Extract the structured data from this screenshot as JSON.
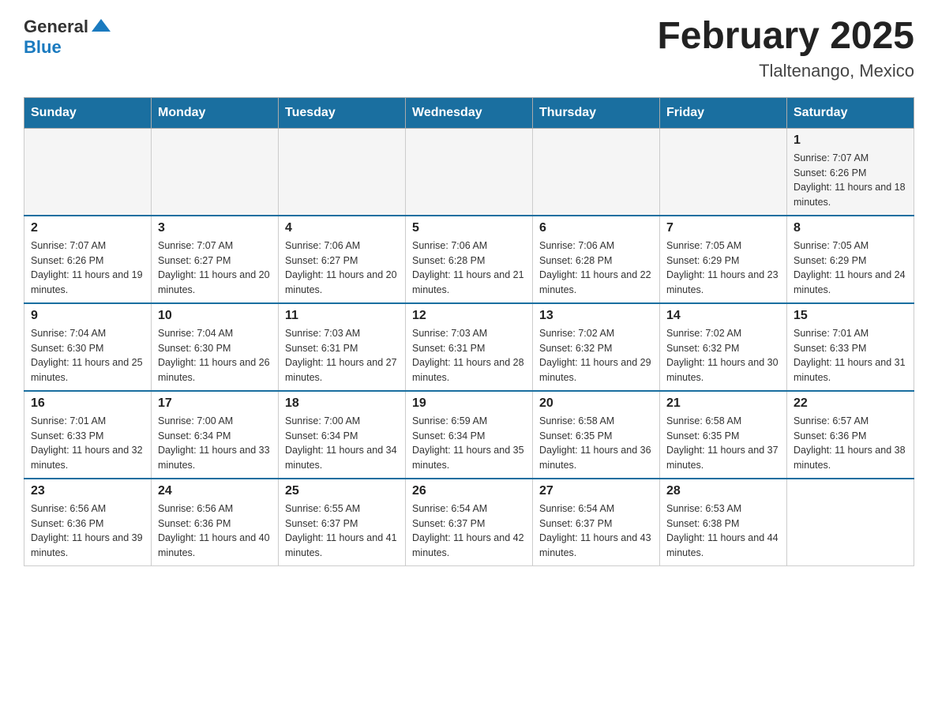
{
  "header": {
    "logo": {
      "general": "General",
      "arrow_icon": "▶",
      "blue": "Blue"
    },
    "title": "February 2025",
    "location": "Tlaltenango, Mexico"
  },
  "days_of_week": [
    "Sunday",
    "Monday",
    "Tuesday",
    "Wednesday",
    "Thursday",
    "Friday",
    "Saturday"
  ],
  "weeks": [
    {
      "days": [
        {
          "date": "",
          "sunrise": "",
          "sunset": "",
          "daylight": ""
        },
        {
          "date": "",
          "sunrise": "",
          "sunset": "",
          "daylight": ""
        },
        {
          "date": "",
          "sunrise": "",
          "sunset": "",
          "daylight": ""
        },
        {
          "date": "",
          "sunrise": "",
          "sunset": "",
          "daylight": ""
        },
        {
          "date": "",
          "sunrise": "",
          "sunset": "",
          "daylight": ""
        },
        {
          "date": "",
          "sunrise": "",
          "sunset": "",
          "daylight": ""
        },
        {
          "date": "1",
          "sunrise": "Sunrise: 7:07 AM",
          "sunset": "Sunset: 6:26 PM",
          "daylight": "Daylight: 11 hours and 18 minutes."
        }
      ]
    },
    {
      "days": [
        {
          "date": "2",
          "sunrise": "Sunrise: 7:07 AM",
          "sunset": "Sunset: 6:26 PM",
          "daylight": "Daylight: 11 hours and 19 minutes."
        },
        {
          "date": "3",
          "sunrise": "Sunrise: 7:07 AM",
          "sunset": "Sunset: 6:27 PM",
          "daylight": "Daylight: 11 hours and 20 minutes."
        },
        {
          "date": "4",
          "sunrise": "Sunrise: 7:06 AM",
          "sunset": "Sunset: 6:27 PM",
          "daylight": "Daylight: 11 hours and 20 minutes."
        },
        {
          "date": "5",
          "sunrise": "Sunrise: 7:06 AM",
          "sunset": "Sunset: 6:28 PM",
          "daylight": "Daylight: 11 hours and 21 minutes."
        },
        {
          "date": "6",
          "sunrise": "Sunrise: 7:06 AM",
          "sunset": "Sunset: 6:28 PM",
          "daylight": "Daylight: 11 hours and 22 minutes."
        },
        {
          "date": "7",
          "sunrise": "Sunrise: 7:05 AM",
          "sunset": "Sunset: 6:29 PM",
          "daylight": "Daylight: 11 hours and 23 minutes."
        },
        {
          "date": "8",
          "sunrise": "Sunrise: 7:05 AM",
          "sunset": "Sunset: 6:29 PM",
          "daylight": "Daylight: 11 hours and 24 minutes."
        }
      ]
    },
    {
      "days": [
        {
          "date": "9",
          "sunrise": "Sunrise: 7:04 AM",
          "sunset": "Sunset: 6:30 PM",
          "daylight": "Daylight: 11 hours and 25 minutes."
        },
        {
          "date": "10",
          "sunrise": "Sunrise: 7:04 AM",
          "sunset": "Sunset: 6:30 PM",
          "daylight": "Daylight: 11 hours and 26 minutes."
        },
        {
          "date": "11",
          "sunrise": "Sunrise: 7:03 AM",
          "sunset": "Sunset: 6:31 PM",
          "daylight": "Daylight: 11 hours and 27 minutes."
        },
        {
          "date": "12",
          "sunrise": "Sunrise: 7:03 AM",
          "sunset": "Sunset: 6:31 PM",
          "daylight": "Daylight: 11 hours and 28 minutes."
        },
        {
          "date": "13",
          "sunrise": "Sunrise: 7:02 AM",
          "sunset": "Sunset: 6:32 PM",
          "daylight": "Daylight: 11 hours and 29 minutes."
        },
        {
          "date": "14",
          "sunrise": "Sunrise: 7:02 AM",
          "sunset": "Sunset: 6:32 PM",
          "daylight": "Daylight: 11 hours and 30 minutes."
        },
        {
          "date": "15",
          "sunrise": "Sunrise: 7:01 AM",
          "sunset": "Sunset: 6:33 PM",
          "daylight": "Daylight: 11 hours and 31 minutes."
        }
      ]
    },
    {
      "days": [
        {
          "date": "16",
          "sunrise": "Sunrise: 7:01 AM",
          "sunset": "Sunset: 6:33 PM",
          "daylight": "Daylight: 11 hours and 32 minutes."
        },
        {
          "date": "17",
          "sunrise": "Sunrise: 7:00 AM",
          "sunset": "Sunset: 6:34 PM",
          "daylight": "Daylight: 11 hours and 33 minutes."
        },
        {
          "date": "18",
          "sunrise": "Sunrise: 7:00 AM",
          "sunset": "Sunset: 6:34 PM",
          "daylight": "Daylight: 11 hours and 34 minutes."
        },
        {
          "date": "19",
          "sunrise": "Sunrise: 6:59 AM",
          "sunset": "Sunset: 6:34 PM",
          "daylight": "Daylight: 11 hours and 35 minutes."
        },
        {
          "date": "20",
          "sunrise": "Sunrise: 6:58 AM",
          "sunset": "Sunset: 6:35 PM",
          "daylight": "Daylight: 11 hours and 36 minutes."
        },
        {
          "date": "21",
          "sunrise": "Sunrise: 6:58 AM",
          "sunset": "Sunset: 6:35 PM",
          "daylight": "Daylight: 11 hours and 37 minutes."
        },
        {
          "date": "22",
          "sunrise": "Sunrise: 6:57 AM",
          "sunset": "Sunset: 6:36 PM",
          "daylight": "Daylight: 11 hours and 38 minutes."
        }
      ]
    },
    {
      "days": [
        {
          "date": "23",
          "sunrise": "Sunrise: 6:56 AM",
          "sunset": "Sunset: 6:36 PM",
          "daylight": "Daylight: 11 hours and 39 minutes."
        },
        {
          "date": "24",
          "sunrise": "Sunrise: 6:56 AM",
          "sunset": "Sunset: 6:36 PM",
          "daylight": "Daylight: 11 hours and 40 minutes."
        },
        {
          "date": "25",
          "sunrise": "Sunrise: 6:55 AM",
          "sunset": "Sunset: 6:37 PM",
          "daylight": "Daylight: 11 hours and 41 minutes."
        },
        {
          "date": "26",
          "sunrise": "Sunrise: 6:54 AM",
          "sunset": "Sunset: 6:37 PM",
          "daylight": "Daylight: 11 hours and 42 minutes."
        },
        {
          "date": "27",
          "sunrise": "Sunrise: 6:54 AM",
          "sunset": "Sunset: 6:37 PM",
          "daylight": "Daylight: 11 hours and 43 minutes."
        },
        {
          "date": "28",
          "sunrise": "Sunrise: 6:53 AM",
          "sunset": "Sunset: 6:38 PM",
          "daylight": "Daylight: 11 hours and 44 minutes."
        },
        {
          "date": "",
          "sunrise": "",
          "sunset": "",
          "daylight": ""
        }
      ]
    }
  ]
}
